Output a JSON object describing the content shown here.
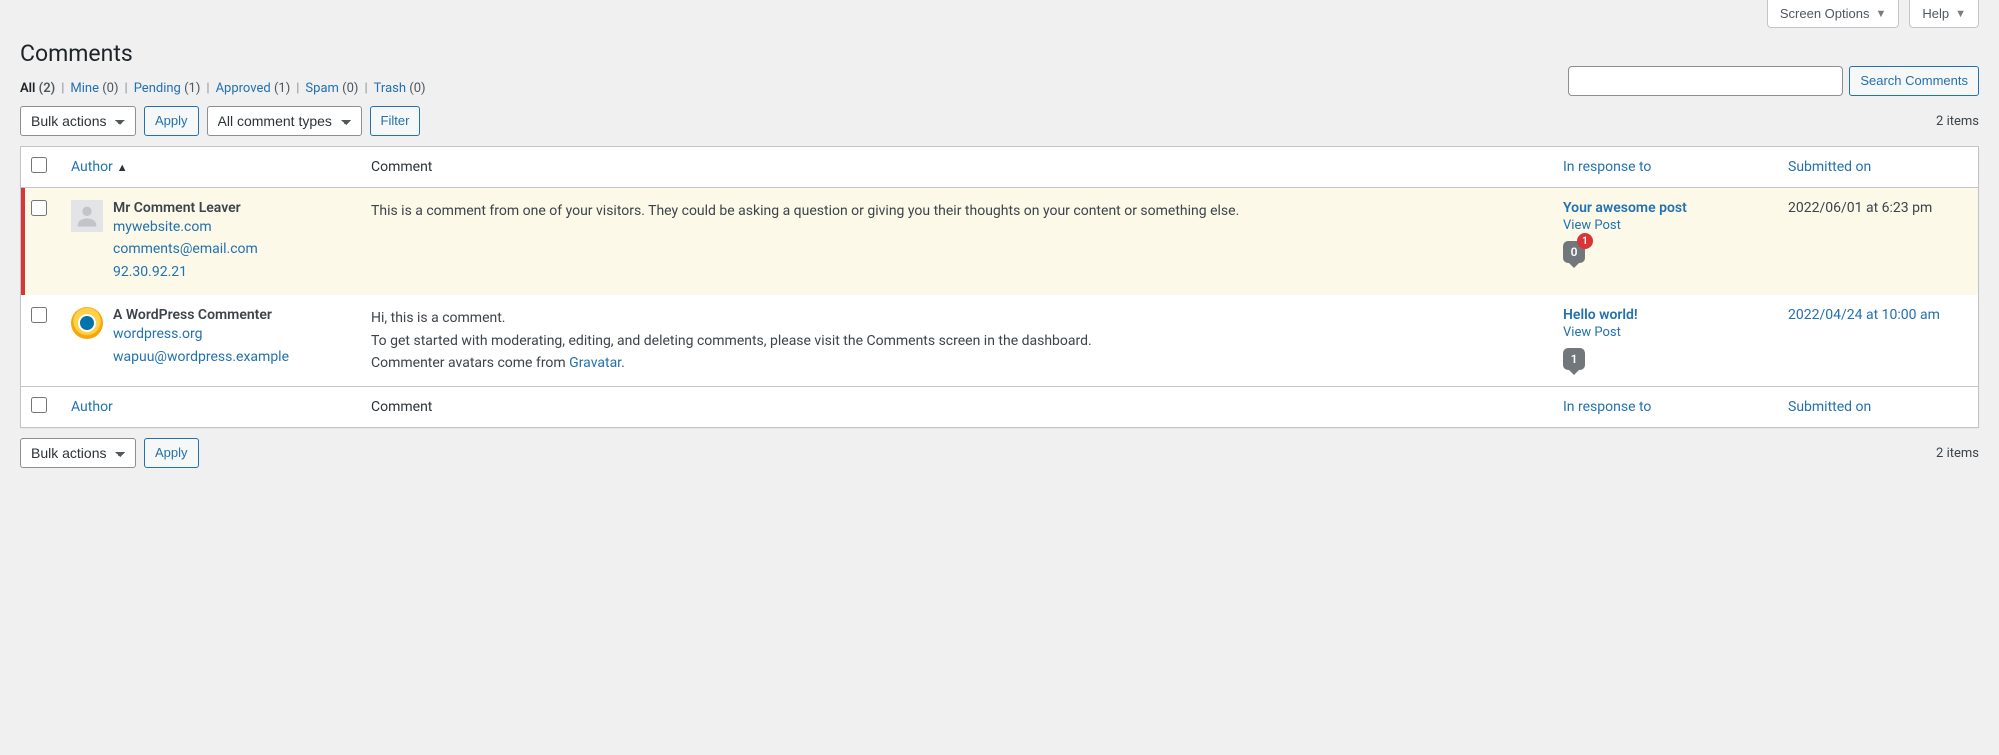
{
  "top": {
    "screen_options": "Screen Options",
    "help": "Help"
  },
  "page_title": "Comments",
  "filters": {
    "all": {
      "label": "All",
      "count": "(2)"
    },
    "mine": {
      "label": "Mine",
      "count": "(0)"
    },
    "pending": {
      "label": "Pending",
      "count": "(1)"
    },
    "approved": {
      "label": "Approved",
      "count": "(1)"
    },
    "spam": {
      "label": "Spam",
      "count": "(0)"
    },
    "trash": {
      "label": "Trash",
      "count": "(0)"
    }
  },
  "search": {
    "button": "Search Comments"
  },
  "bulk": {
    "select_label": "Bulk actions",
    "apply": "Apply",
    "type_label": "All comment types",
    "filter": "Filter"
  },
  "pagination": {
    "items": "2 items"
  },
  "columns": {
    "author": "Author",
    "comment": "Comment",
    "response": "In response to",
    "submitted": "Submitted on"
  },
  "rows": [
    {
      "author_name": "Mr Comment Leaver",
      "author_url": "mywebsite.com",
      "author_email": "comments@email.com",
      "author_ip": "92.30.92.21",
      "comment_text": "This is a comment from one of your visitors. They could be asking a question or giving you their thoughts on your content or something else.",
      "post_title": "Your awesome post",
      "view_post": "View Post",
      "bubble": "0",
      "badge": "1",
      "submitted": "2022/06/01 at 6:23 pm"
    },
    {
      "author_name": "A WordPress Commenter",
      "author_url": "wordpress.org",
      "author_email": "wapuu@wordpress.example",
      "comment_line1": "Hi, this is a comment.",
      "comment_line2": "To get started with moderating, editing, and deleting comments, please visit the Comments screen in the dashboard.",
      "comment_line3a": "Commenter avatars come from ",
      "comment_link": "Gravatar",
      "comment_line3b": ".",
      "post_title": "Hello world!",
      "view_post": "View Post",
      "bubble": "1",
      "submitted": "2022/04/24 at 10:00 am"
    }
  ]
}
